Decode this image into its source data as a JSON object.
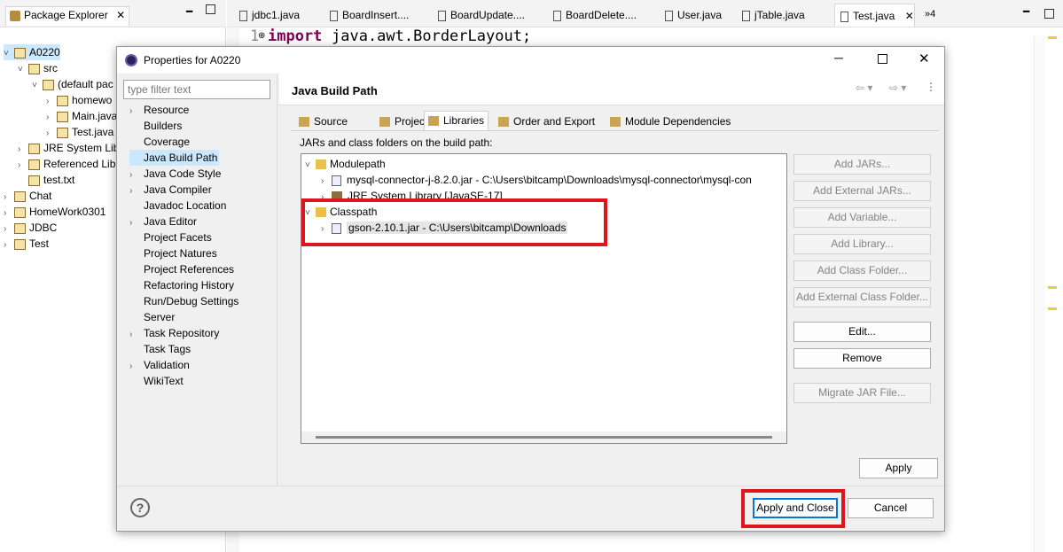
{
  "explorer": {
    "title": "Package Explorer",
    "tree": [
      {
        "label": "A0220",
        "indent": 0,
        "tw": "˅"
      },
      {
        "label": "src",
        "indent": 1,
        "tw": "˅"
      },
      {
        "label": "(default pac",
        "indent": 2,
        "tw": "˅"
      },
      {
        "label": "homewo",
        "indent": 3,
        "tw": "›"
      },
      {
        "label": "Main.java",
        "indent": 3,
        "tw": "›"
      },
      {
        "label": "Test.java",
        "indent": 3,
        "tw": "›"
      },
      {
        "label": "JRE System Lib",
        "indent": 1,
        "tw": "›"
      },
      {
        "label": "Referenced Lib",
        "indent": 1,
        "tw": "›"
      },
      {
        "label": "test.txt",
        "indent": 1,
        "tw": ""
      },
      {
        "label": "Chat",
        "indent": 0,
        "tw": "›"
      },
      {
        "label": "HomeWork0301",
        "indent": 0,
        "tw": "›"
      },
      {
        "label": "JDBC",
        "indent": 0,
        "tw": "›"
      },
      {
        "label": "Test",
        "indent": 0,
        "tw": "›"
      }
    ]
  },
  "editor": {
    "tabs": [
      "jdbc1.java",
      "BoardInsert....",
      "BoardUpdate....",
      "BoardDelete....",
      "User.java",
      "jTable.java",
      "Test.java"
    ],
    "overflow": "»4",
    "line_number": "1",
    "code_keyword": "import",
    "code_rest": "java.awt.BorderLayout;"
  },
  "dialog": {
    "title": "Properties for A0220",
    "filter_placeholder": "type filter text",
    "nav": [
      {
        "label": "Resource",
        "expand": "›"
      },
      {
        "label": "Builders",
        "expand": ""
      },
      {
        "label": "Coverage",
        "expand": ""
      },
      {
        "label": "Java Build Path",
        "expand": "",
        "selected": true
      },
      {
        "label": "Java Code Style",
        "expand": "›"
      },
      {
        "label": "Java Compiler",
        "expand": "›"
      },
      {
        "label": "Javadoc Location",
        "expand": ""
      },
      {
        "label": "Java Editor",
        "expand": "›"
      },
      {
        "label": "Project Facets",
        "expand": ""
      },
      {
        "label": "Project Natures",
        "expand": ""
      },
      {
        "label": "Project References",
        "expand": ""
      },
      {
        "label": "Refactoring History",
        "expand": ""
      },
      {
        "label": "Run/Debug Settings",
        "expand": ""
      },
      {
        "label": "Server",
        "expand": ""
      },
      {
        "label": "Task Repository",
        "expand": "›"
      },
      {
        "label": "Task Tags",
        "expand": ""
      },
      {
        "label": "Validation",
        "expand": "›"
      },
      {
        "label": "WikiText",
        "expand": ""
      }
    ],
    "page_title": "Java Build Path",
    "build_tabs": [
      "Source",
      "Projects",
      "Libraries",
      "Order and Export",
      "Module Dependencies"
    ],
    "list_caption": "JARs and class folders on the build path:",
    "lib_tree": {
      "modulepath": "Modulepath",
      "mysql_jar": "mysql-connector-j-8.2.0.jar - C:\\Users\\bitcamp\\Downloads\\mysql-connector\\mysql-con",
      "jre": "JRE System Library [JavaSE-17]",
      "classpath": "Classpath",
      "gson_jar": "gson-2.10.1.jar - C:\\Users\\bitcamp\\Downloads"
    },
    "side_buttons": [
      "Add JARs...",
      "Add External JARs...",
      "Add Variable...",
      "Add Library...",
      "Add Class Folder...",
      "Add External Class Folder..."
    ],
    "edit_label": "Edit...",
    "remove_label": "Remove",
    "migrate_label": "Migrate JAR File...",
    "apply_label": "Apply",
    "apply_close_label": "Apply and Close",
    "cancel_label": "Cancel",
    "help": "?"
  },
  "colors": {
    "highlight": "#e0141e",
    "selection": "#cce8ff",
    "keyword": "#7f0055"
  }
}
